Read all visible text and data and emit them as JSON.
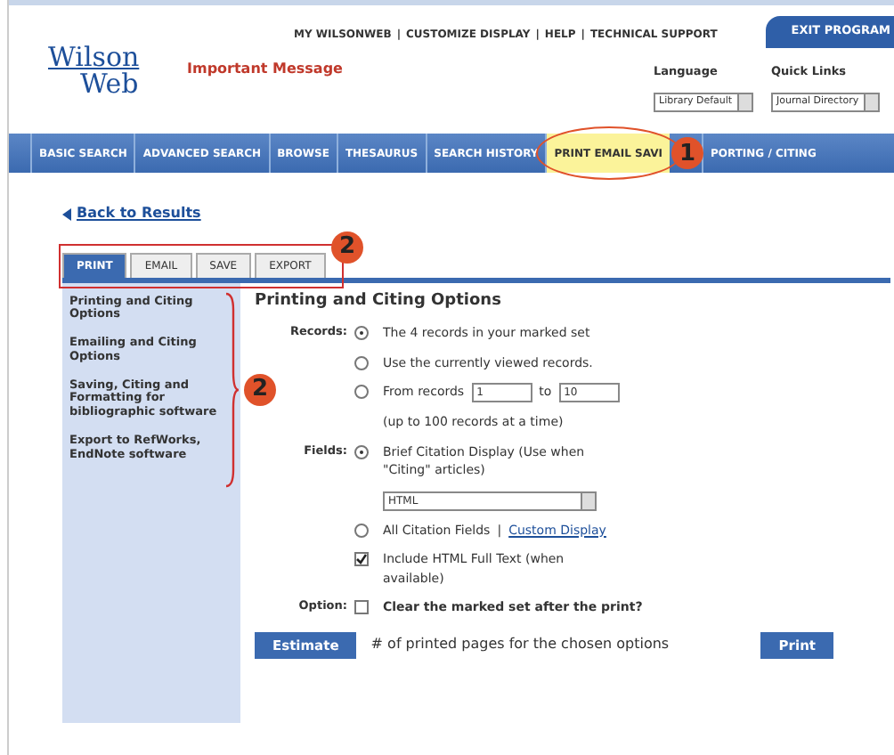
{
  "header": {
    "logo": {
      "line1": "Wilson",
      "line2": "Web"
    },
    "important_message": "Important Message",
    "top_links": [
      {
        "label": "MY WILSONWEB",
        "separator": "|"
      },
      {
        "label": "CUSTOMIZE DISPLAY",
        "separator": "|"
      },
      {
        "label": "HELP",
        "separator": "|"
      },
      {
        "label": "TECHNICAL SUPPORT"
      }
    ],
    "exit_button": "EXIT PROGRAM",
    "language": {
      "label": "Language",
      "value": "Library Default"
    },
    "quick_links": {
      "label": "Quick Links",
      "value": "Journal Directory"
    }
  },
  "nav": [
    {
      "label": "BASIC SEARCH",
      "selected": false
    },
    {
      "label": "ADVANCED SEARCH",
      "selected": false
    },
    {
      "label": "BROWSE",
      "selected": false
    },
    {
      "label": "THESAURUS",
      "selected": false
    },
    {
      "label": "SEARCH HISTORY",
      "selected": false
    },
    {
      "label": "PRINT EMAIL SAVI",
      "selected": true
    },
    {
      "label": "PORTING / CITING",
      "selected": false
    }
  ],
  "back_link": "Back to Results",
  "tabs": [
    {
      "label": "PRINT",
      "selected": true
    },
    {
      "label": "EMAIL",
      "selected": false
    },
    {
      "label": "SAVE",
      "selected": false
    },
    {
      "label": "EXPORT",
      "selected": false
    }
  ],
  "sidebar": {
    "items": [
      "Printing and Citing Options",
      "Emailing and Citing Options",
      "Saving, Citing and Formatting for bibliographic software",
      "Export to RefWorks, EndNote software"
    ]
  },
  "panel": {
    "title": "Printing and Citing Options",
    "records": {
      "label": "Records:",
      "options": [
        {
          "kind": "plain",
          "label": "The 4 records in your marked set",
          "selected": true
        },
        {
          "kind": "plain",
          "label": "Use the currently viewed records.",
          "selected": false
        },
        {
          "kind": "range",
          "label": "From records",
          "from": "1",
          "to_label": "to",
          "to": "10",
          "selected": false
        }
      ],
      "note": "(up to 100 records at a time)"
    },
    "fields": {
      "label": "Fields:",
      "options": [
        {
          "label": "Brief Citation Display (Use when \"Citing\" articles)",
          "selected": true,
          "format": "HTML"
        },
        {
          "label": "All Citation Fields",
          "separator": "|",
          "link": "Custom Display",
          "selected": false
        }
      ],
      "full_text": {
        "label": "Include HTML Full Text (when available)",
        "checked": true
      }
    },
    "option": {
      "label": "Option:",
      "text": "Clear the marked set after the print?",
      "checked": false
    },
    "estimate_button": "Estimate",
    "estimate_text": "# of printed pages for the chosen options",
    "print_button": "Print"
  },
  "annotations": [
    {
      "label": "1"
    },
    {
      "label": "2"
    },
    {
      "label": "2"
    }
  ]
}
